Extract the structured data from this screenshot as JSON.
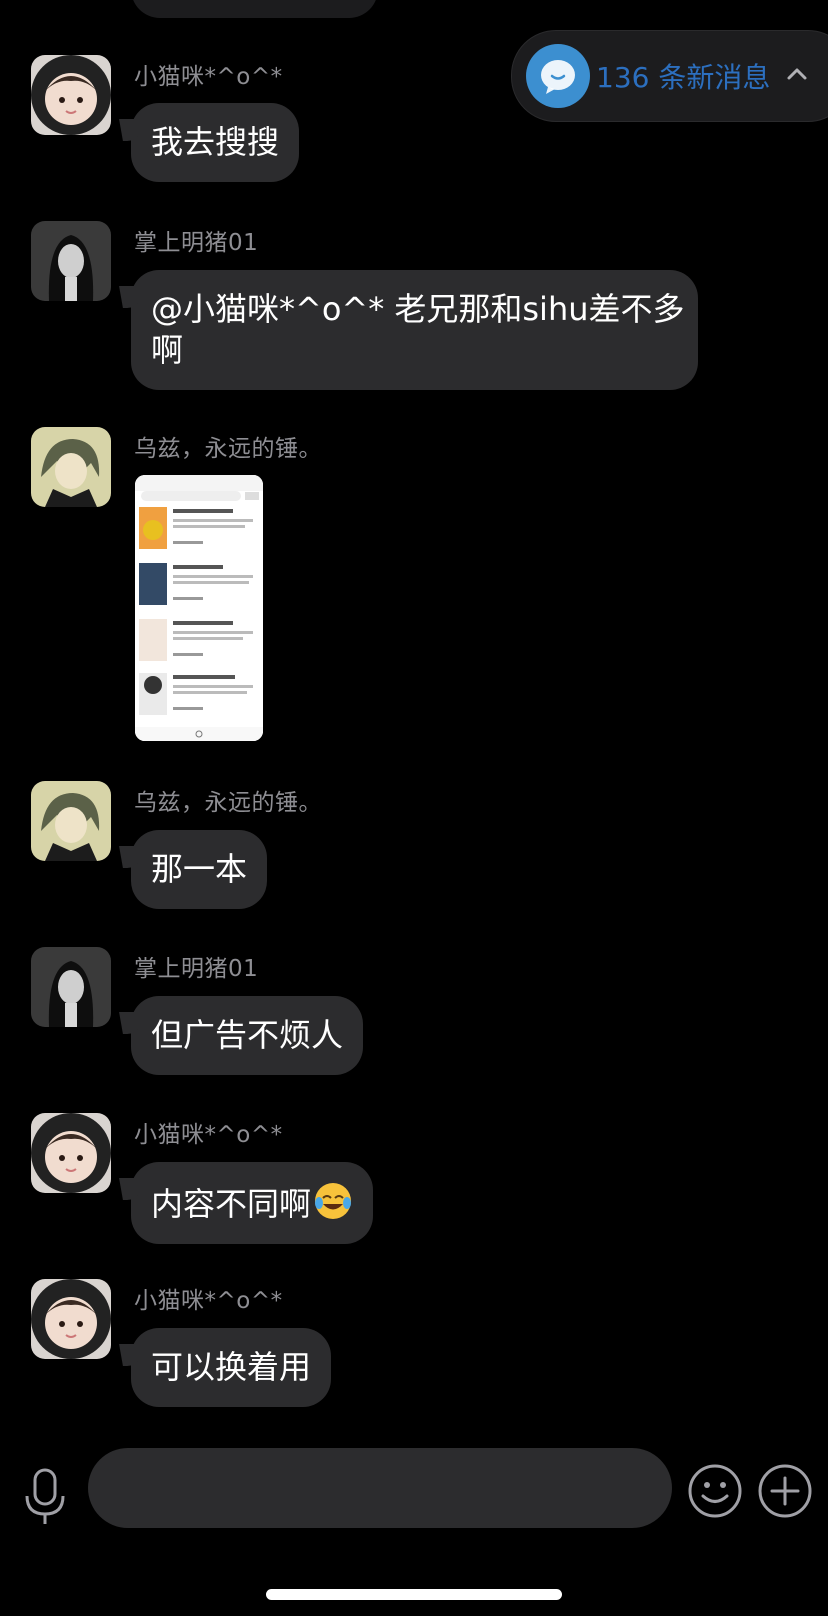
{
  "new_messages": {
    "count_label": "136 条新消息"
  },
  "messages": [
    {
      "sender": "小猫咪*^o^*",
      "text": "我去搜搜",
      "avatar": "girl-avatar"
    },
    {
      "sender": "掌上明猪01",
      "text_line1": "@小猫咪*^o^* 老兄那和sihu差不多",
      "text_line2": "啊",
      "avatar": "dark-hair-avatar"
    },
    {
      "sender": "乌兹，永远的锤。",
      "type": "image",
      "avatar": "anime-avatar"
    },
    {
      "sender": "乌兹，永远的锤。",
      "text": "那一本",
      "avatar": "anime-avatar"
    },
    {
      "sender": "掌上明猪01",
      "text": "但广告不烦人",
      "avatar": "dark-hair-avatar"
    },
    {
      "sender": "小猫咪*^o^*",
      "text": "内容不同啊",
      "emoji": "laughing-tears-emoji",
      "avatar": "girl-avatar"
    },
    {
      "sender": "小猫咪*^o^*",
      "text": "可以换着用",
      "avatar": "girl-avatar"
    }
  ],
  "input": {
    "placeholder": ""
  },
  "colors": {
    "bubble": "#2c2c2e",
    "background": "#000000",
    "accent": "#2c6fbf",
    "nickname": "#8e8e93"
  }
}
